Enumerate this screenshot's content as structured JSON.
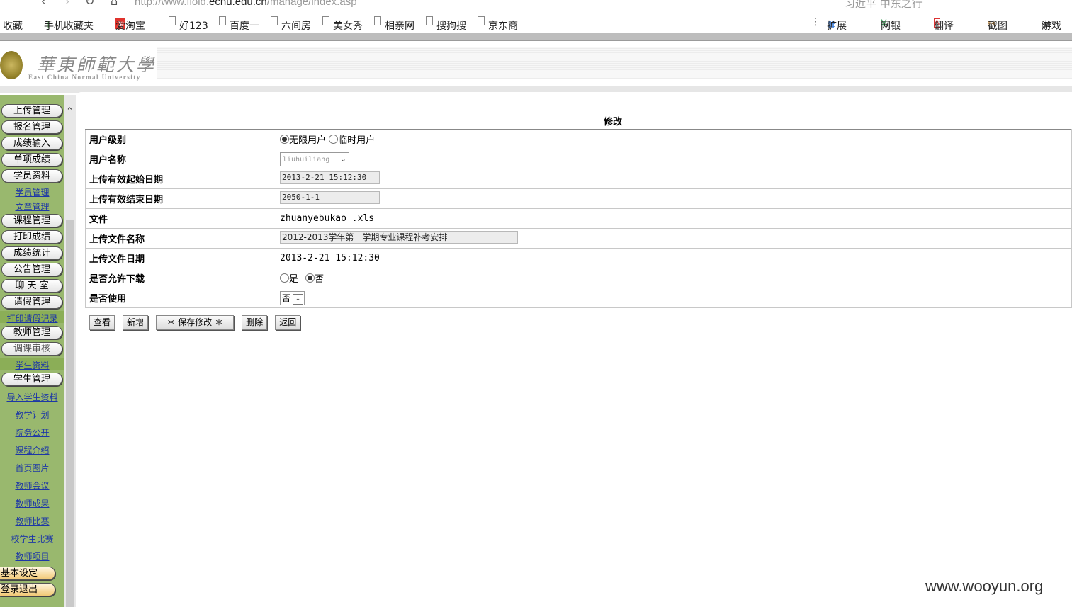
{
  "browser": {
    "url_prefix": "http://www.fiold.",
    "url_domain": "ecnu.edu.cn",
    "url_path": "/manage/index.asp",
    "search_hint": "习近平 中东之行",
    "favorites_label": "收藏",
    "favorites": [
      "手机收藏夹",
      "爱淘宝",
      "好123",
      "百度一",
      "六间房",
      "美女秀",
      "相亲网",
      "搜狗搜",
      "京东商"
    ],
    "tools": [
      "扩展",
      "网银",
      "翻译",
      "截图",
      "游戏"
    ]
  },
  "header": {
    "logo_cn": "華東師範大學",
    "logo_en": "East China Normal University"
  },
  "sidebar": {
    "upload": "上传管理",
    "signup": "报名管理",
    "score_input": "成绩输入",
    "single_score": "单项成绩",
    "student_info": "学员资料",
    "student_manage": "学员管理",
    "article_manage": "文章管理",
    "course_manage": "课程管理",
    "print_score": "打印成绩",
    "score_stats": "成绩统计",
    "notice_manage": "公告管理",
    "chat_room": "聊 天 室",
    "leave_manage": "请假管理",
    "print_leave": "打印请假记录",
    "teacher_manage": "教师管理",
    "class_review": "调课审核",
    "student_data": "学生资料",
    "student_mgmt": "学生管理",
    "import_student": "导入学生资料",
    "teaching_plan": "教学计划",
    "affairs_public": "院务公开",
    "course_intro": "课程介绍",
    "home_images": "首页图片",
    "teacher_meeting": "教师会议",
    "teacher_results": "教师成果",
    "teacher_contest": "教师比赛",
    "student_contest": "校学生比赛",
    "teacher_project": "教师项目",
    "basic_settings": "基本设定",
    "logout": "登录退出"
  },
  "form": {
    "title": "修改",
    "user_level_label": "用户级别",
    "user_level_options": [
      "无限用户",
      "临时用户"
    ],
    "user_level_selected": "无限用户",
    "username_label": "用户名称",
    "username_value": "liuhuiliang",
    "start_date_label": "上传有效起始日期",
    "start_date_value": "2013-2-21 15:12:30",
    "end_date_label": "上传有效结束日期",
    "end_date_value": "2050-1-1",
    "file_label": "文件",
    "file_value": "zhuanyebukao .xls",
    "upload_name_label": "上传文件名称",
    "upload_name_value": "2012-2013学年第一学期专业课程补考安排",
    "upload_date_label": "上传文件日期",
    "upload_date_value": "2013-2-21 15:12:30",
    "allow_download_label": "是否允许下载",
    "allow_download_options": [
      "是",
      "否"
    ],
    "allow_download_selected": "否",
    "in_use_label": "是否使用",
    "in_use_value": "否"
  },
  "buttons": {
    "view": "查看",
    "add": "新增",
    "save": "＊ 保存修改 ＊",
    "delete": "删除",
    "back": "返回"
  },
  "watermark": "www.wooyun.org"
}
